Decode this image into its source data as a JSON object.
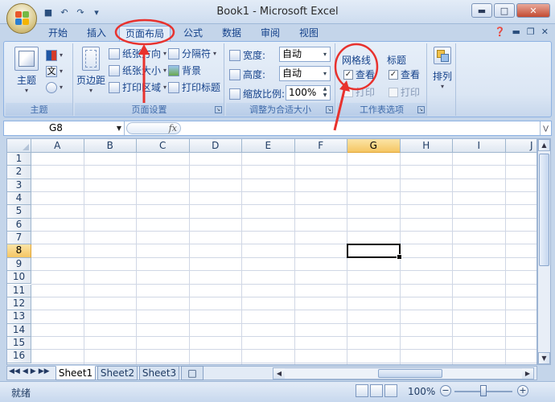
{
  "window": {
    "title": "Book1 - Microsoft Excel"
  },
  "quick_access": {
    "icons": [
      "save-icon",
      "undo-icon",
      "redo-icon",
      "customize-icon"
    ]
  },
  "tabs": [
    "开始",
    "插入",
    "页面布局",
    "公式",
    "数据",
    "审阅",
    "视图"
  ],
  "active_tab": "页面布局",
  "ribbon": {
    "theme": {
      "label": "主题",
      "group": "主题"
    },
    "page_setup": {
      "group": "页面设置",
      "margins": "页边距",
      "orientation": "纸张方向",
      "size": "纸张大小",
      "print_area": "打印区域",
      "breaks": "分隔符",
      "background": "背景",
      "print_titles": "打印标题"
    },
    "scale": {
      "group": "调整为合适大小",
      "width_label": "宽度:",
      "width_value": "自动",
      "height_label": "高度:",
      "height_value": "自动",
      "scale_label": "缩放比例:",
      "scale_value": "100%"
    },
    "sheet_options": {
      "group": "工作表选项",
      "gridlines": "网格线",
      "headings": "标题",
      "view": "查看",
      "print": "打印",
      "gridlines_view": true,
      "gridlines_print": false,
      "headings_view": true,
      "headings_print": false
    },
    "arrange": {
      "label": "排列"
    }
  },
  "formula_bar": {
    "name_box": "G8",
    "fx": "fx",
    "formula": ""
  },
  "grid": {
    "columns": [
      "A",
      "B",
      "C",
      "D",
      "E",
      "F",
      "G",
      "H",
      "I",
      "J"
    ],
    "rows": [
      "1",
      "2",
      "3",
      "4",
      "5",
      "6",
      "7",
      "8",
      "9",
      "10",
      "11",
      "12",
      "13",
      "14",
      "15",
      "16"
    ],
    "selected_column": "G",
    "selected_row": "8"
  },
  "sheets": [
    "Sheet1",
    "Sheet2",
    "Sheet3"
  ],
  "active_sheet": "Sheet1",
  "status": {
    "text": "就绪",
    "zoom": "100%"
  },
  "annotation_color": "#e8322e"
}
